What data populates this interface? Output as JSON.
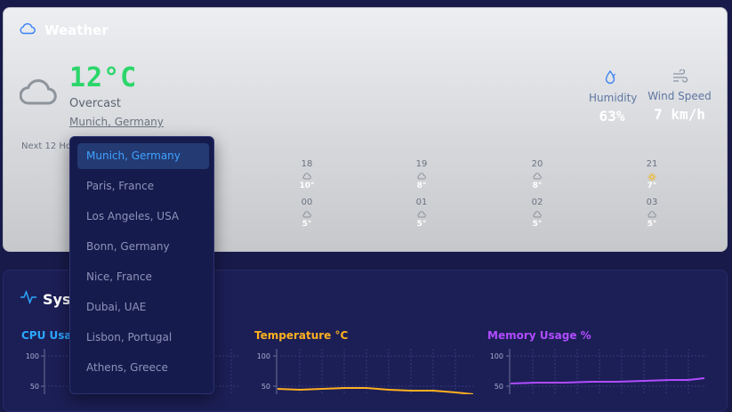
{
  "weather": {
    "title": "Weather",
    "temperature": "12°C",
    "condition": "Overcast",
    "location": "Munich, Germany",
    "humidity_label": "Humidity",
    "humidity_value": "63%",
    "wind_label": "Wind Speed",
    "wind_value": "7 km/h",
    "next_label": "Next 12 Hou",
    "forecast": [
      {
        "hour": "18",
        "icon": "cloud-icon",
        "temp": "10°"
      },
      {
        "hour": "19",
        "icon": "cloud-icon",
        "temp": "8°"
      },
      {
        "hour": "20",
        "icon": "cloud-icon",
        "temp": "8°"
      },
      {
        "hour": "21",
        "icon": "sun-icon",
        "temp": "7°"
      },
      {
        "hour": "00",
        "icon": "cloud-icon",
        "temp": "5°"
      },
      {
        "hour": "01",
        "icon": "cloud-icon",
        "temp": "5°"
      },
      {
        "hour": "02",
        "icon": "cloud-icon",
        "temp": "5°"
      },
      {
        "hour": "03",
        "icon": "cloud-icon",
        "temp": "5°"
      }
    ]
  },
  "system": {
    "title": "Sys",
    "charts": [
      {
        "title": "CPU Usage",
        "color": "#2ca7ff",
        "ticks": [
          "100",
          "50"
        ]
      },
      {
        "title": "Temperature °C",
        "color": "#ffb020",
        "ticks": [
          "100",
          "50"
        ]
      },
      {
        "title": "Memory Usage %",
        "color": "#b04cff",
        "ticks": [
          "100",
          "50"
        ]
      }
    ]
  },
  "dropdown": {
    "selected": "Munich, Germany",
    "options": [
      "Munich, Germany",
      "Paris, France",
      "Los Angeles, USA",
      "Bonn, Germany",
      "Nice, France",
      "Dubai, UAE",
      "Lisbon, Portugal",
      "Athens, Greece"
    ]
  }
}
